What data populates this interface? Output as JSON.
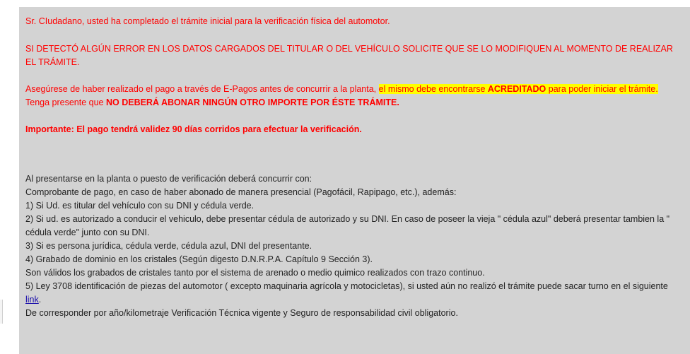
{
  "notice": {
    "line1": "Sr. CIudadano, usted ha completado el trámite inicial para la verificación física del automotor.",
    "warning": "SI DETECTÓ ALGÚN ERROR EN LOS DATOS CARGADOS DEL TITULAR O DEL VEHÍCULO SOLICITE QUE SE LO MODIFIQUEN AL MOMENTO DE REALIZAR EL TRÁMITE.",
    "payment_pre": "Asegúrese de haber realizado el pago a través de E-Pagos antes de concurrir a la planta, ",
    "payment_hl_pre": "el mismo debe encontrarse ",
    "payment_hl_bold": "ACREDITADO",
    "payment_hl_post": " para poder iniciar el trámite.",
    "tenga_pre": "Tenga presente que ",
    "tenga_bold": "NO DEBERÁ ABONAR NINGÚN OTRO IMPORTE POR ÉSTE TRÁMITE.",
    "importante": "Importante: El pago tendrá validez 90 días corridos para efectuar la verificación."
  },
  "requirements": {
    "intro": "Al presentarse en la planta o puesto de verificación deberá concurrir con:",
    "comprobante": "Comprobante de pago, en caso de haber abonado de manera presencial (Pagofácil, Rapipago, etc.), además:",
    "item1": "1) Si Ud. es titular del vehículo con su DNI y cédula verde.",
    "item2": "2) Si ud. es autorizado a conducir el vehiculo, debe presentar cédula de autorizado y su DNI. En caso de poseer la vieja \" cédula azul\" deberá presentar tambien la \" cédula verde\" junto con su DNI.",
    "item3": "3) Si es persona jurídica, cédula verde, cédula azul, DNI del presentante.",
    "item4": "4) Grabado de dominio en los cristales (Según digesto D.N.R.P.A. Capítulo 9 Sección 3).",
    "cristales": "Son válidos los grabados de cristales tanto por el sistema de arenado o medio quimico realizados con trazo continuo.",
    "item5_pre": "5) Ley 3708 identificación de piezas del automotor ( excepto maquinaria agrícola y motocicletas), si usted aún no realizó el trámite puede sacar turno en el siguiente ",
    "item5_link": "link",
    "item5_post": ".",
    "final": "De corresponder por año/kilometraje Verificación Técnica vigente y Seguro de responsabilidad civil obligatorio."
  }
}
